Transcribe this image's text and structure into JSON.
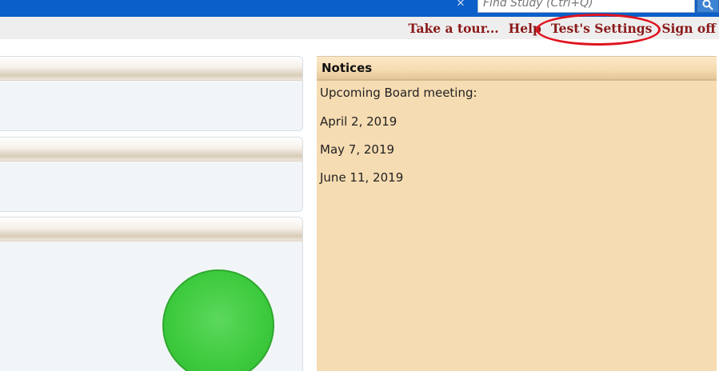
{
  "header": {
    "search": {
      "placeholder": "Find Study (Ctrl+Q)"
    }
  },
  "nav": {
    "links": [
      {
        "label": "Take a tour..."
      },
      {
        "label": "Help"
      },
      {
        "label": "Test's Settings"
      },
      {
        "label": "Sign off"
      }
    ]
  },
  "notices": {
    "title": "Notices",
    "lines": [
      "Upcoming Board meeting:",
      "April 2, 2019",
      "May 7, 2019",
      "June 11, 2019"
    ]
  },
  "colors": {
    "topbar": "#0b5fc8",
    "nav_link": "#8b1a1a",
    "notices_bg": "#f6dcb2",
    "annotation": "#e0131f",
    "status_indicator": "#3fcb3f"
  },
  "icons": {
    "clear_search": "close-icon",
    "search_button": "search-icon",
    "status": "status-indicator-green"
  }
}
